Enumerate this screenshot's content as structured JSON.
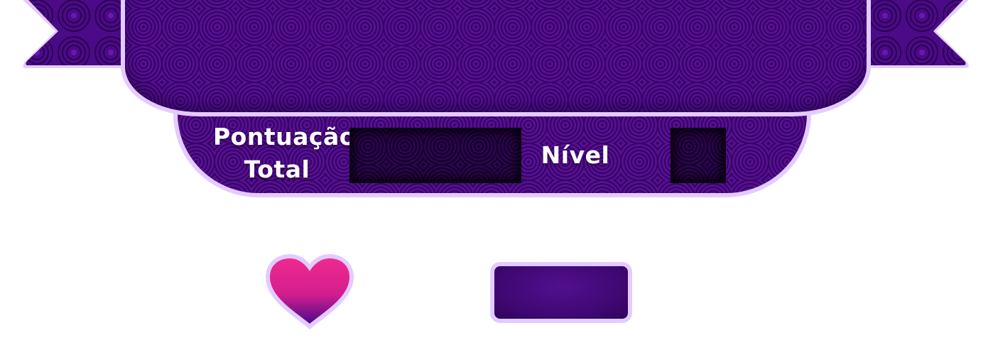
{
  "hud": {
    "score_label": "Pontuação Total",
    "score_label_line1": "Pontuação",
    "score_label_line2": "Total",
    "level_label": "Nível",
    "score_value": "",
    "level_value": "",
    "lives_value": ""
  },
  "icons": {
    "life": "heart-icon"
  },
  "colors": {
    "banner_purple": "#4b0a86",
    "banner_border": "#e4cbff",
    "slot_dark": "#1a0036",
    "heart_top": "#ee2a8f",
    "heart_bottom": "#4a0b8a",
    "text": "#ffffff"
  }
}
